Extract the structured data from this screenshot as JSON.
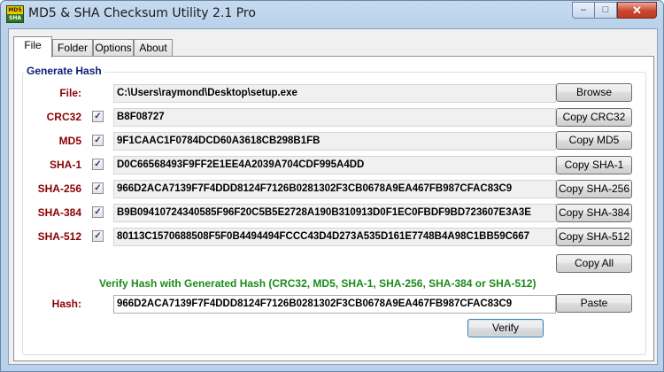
{
  "window": {
    "title": "MD5 & SHA Checksum Utility 2.1 Pro",
    "icon_top": "MD5",
    "icon_bottom": "SHA",
    "controls": {
      "minimize": "–",
      "maximize": "□",
      "close": "✕"
    }
  },
  "tabs": [
    {
      "label": "File",
      "active": true
    },
    {
      "label": "Folder",
      "active": false
    },
    {
      "label": "Options",
      "active": false
    },
    {
      "label": "About",
      "active": false
    }
  ],
  "generate": {
    "title": "Generate Hash",
    "file_label": "File:",
    "file_path": "C:\\Users\\raymond\\Desktop\\setup.exe",
    "browse_label": "Browse",
    "rows": [
      {
        "label": "CRC32",
        "checked": true,
        "value": "B8F08727",
        "button": "Copy CRC32"
      },
      {
        "label": "MD5",
        "checked": true,
        "value": "9F1CAAC1F0784DCD60A3618CB298B1FB",
        "button": "Copy MD5"
      },
      {
        "label": "SHA-1",
        "checked": true,
        "value": "D0C66568493F9FF2E1EE4A2039A704CDF995A4DD",
        "button": "Copy SHA-1"
      },
      {
        "label": "SHA-256",
        "checked": true,
        "value": "966D2ACA7139F7F4DDD8124F7126B0281302F3CB0678A9EA467FB987CFAC83C9",
        "button": "Copy SHA-256"
      },
      {
        "label": "SHA-384",
        "checked": true,
        "value": "B9B09410724340585F96F20C5B5E2728A190B310913D0F1EC0FBDF9BD723607E3A3E",
        "button": "Copy SHA-384"
      },
      {
        "label": "SHA-512",
        "checked": true,
        "value": "80113C1570688508F5F0B4494494FCCC43D4D273A535D161E7748B4A98C1BB59C667",
        "button": "Copy SHA-512"
      }
    ],
    "copy_all_label": "Copy All",
    "check_mark": "✓"
  },
  "verify": {
    "title": "Verify Hash with Generated Hash (CRC32, MD5, SHA-1, SHA-256, SHA-384 or SHA-512)",
    "hash_label": "Hash:",
    "hash_value": "966D2ACA7139F7F4DDD8124F7126B0281302F3CB0678A9EA467FB987CFAC83C9",
    "paste_label": "Paste",
    "verify_label": "Verify"
  }
}
